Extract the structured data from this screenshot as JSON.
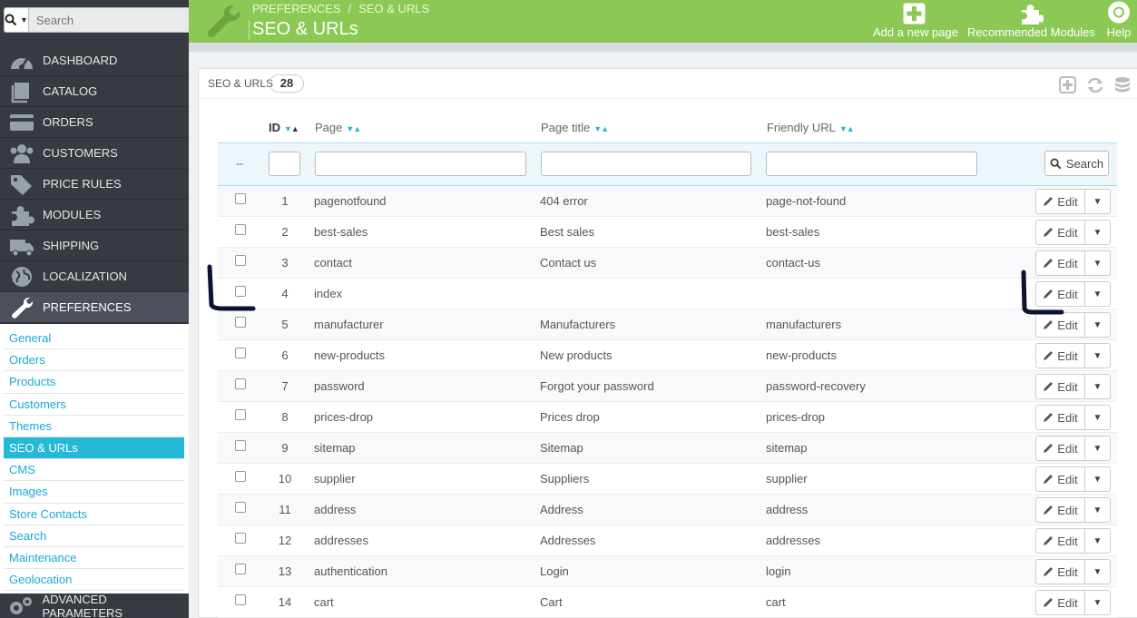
{
  "search": {
    "placeholder": "Search"
  },
  "menu": [
    {
      "label": "DASHBOARD",
      "icon": "dashboard-icon"
    },
    {
      "label": "CATALOG",
      "icon": "book-icon"
    },
    {
      "label": "ORDERS",
      "icon": "credit-card-icon"
    },
    {
      "label": "CUSTOMERS",
      "icon": "users-icon"
    },
    {
      "label": "PRICE RULES",
      "icon": "tags-icon"
    },
    {
      "label": "MODULES",
      "icon": "puzzle-icon"
    },
    {
      "label": "SHIPPING",
      "icon": "truck-icon"
    },
    {
      "label": "LOCALIZATION",
      "icon": "globe-icon"
    },
    {
      "label": "PREFERENCES",
      "icon": "wrench-icon"
    }
  ],
  "submenu": [
    "General",
    "Orders",
    "Products",
    "Customers",
    "Themes",
    "SEO & URLs",
    "CMS",
    "Images",
    "Store Contacts",
    "Search",
    "Maintenance",
    "Geolocation"
  ],
  "submenu_active": "SEO & URLs",
  "advanced": {
    "label": "ADVANCED PARAMETERS"
  },
  "header": {
    "breadcrumb_1": "PREFERENCES",
    "breadcrumb_sep": "/",
    "breadcrumb_2": "SEO & URLS",
    "title": "SEO & URLs",
    "toolbar": {
      "add": "Add a new page",
      "modules": "Recommended Modules",
      "help": "Help"
    }
  },
  "panel": {
    "title": "SEO & URLS",
    "count": "28"
  },
  "table": {
    "columns": {
      "id": "ID",
      "page": "Page",
      "page_title": "Page title",
      "friendly_url": "Friendly URL"
    },
    "filter_dash": "--",
    "search_label": "Search",
    "edit_label": "Edit",
    "rows": [
      {
        "id": "1",
        "page": "pagenotfound",
        "title": "404 error",
        "url": "page-not-found"
      },
      {
        "id": "2",
        "page": "best-sales",
        "title": "Best sales",
        "url": "best-sales"
      },
      {
        "id": "3",
        "page": "contact",
        "title": "Contact us",
        "url": "contact-us"
      },
      {
        "id": "4",
        "page": "index",
        "title": "",
        "url": ""
      },
      {
        "id": "5",
        "page": "manufacturer",
        "title": "Manufacturers",
        "url": "manufacturers"
      },
      {
        "id": "6",
        "page": "new-products",
        "title": "New products",
        "url": "new-products"
      },
      {
        "id": "7",
        "page": "password",
        "title": "Forgot your password",
        "url": "password-recovery"
      },
      {
        "id": "8",
        "page": "prices-drop",
        "title": "Prices drop",
        "url": "prices-drop"
      },
      {
        "id": "9",
        "page": "sitemap",
        "title": "Sitemap",
        "url": "sitemap"
      },
      {
        "id": "10",
        "page": "supplier",
        "title": "Suppliers",
        "url": "supplier"
      },
      {
        "id": "11",
        "page": "address",
        "title": "Address",
        "url": "address"
      },
      {
        "id": "12",
        "page": "addresses",
        "title": "Addresses",
        "url": "addresses"
      },
      {
        "id": "13",
        "page": "authentication",
        "title": "Login",
        "url": "login"
      },
      {
        "id": "14",
        "page": "cart",
        "title": "Cart",
        "url": "cart"
      }
    ]
  },
  "colors": {
    "header": "#8bc954",
    "sidebar": "#363a41",
    "accent": "#25b9d7"
  }
}
